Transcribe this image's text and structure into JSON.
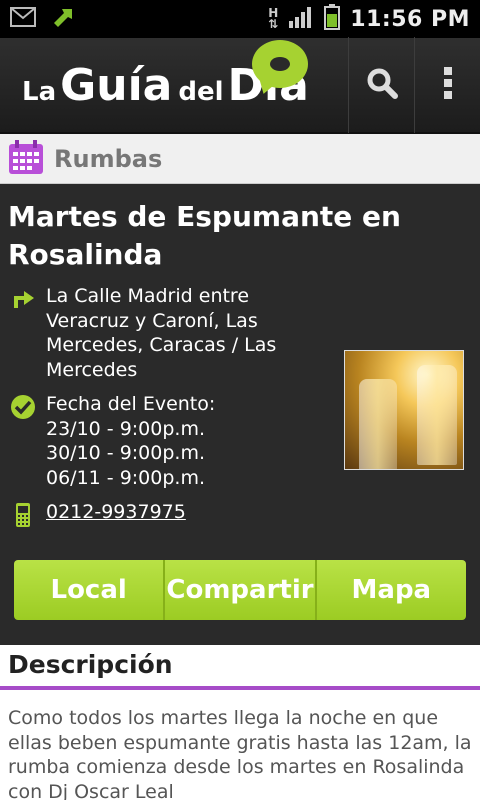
{
  "status_bar": {
    "time": "11:56 PM",
    "network_label": "H"
  },
  "app_bar": {
    "logo_word1": "La",
    "logo_word2": "Guía",
    "logo_word3": "del",
    "logo_word4": "Día",
    "search_icon": "search-icon",
    "overflow_icon": "overflow-menu-icon"
  },
  "category": {
    "icon": "calendar-icon",
    "label": "Rumbas"
  },
  "event": {
    "title": "Martes de Espumante en Rosalinda",
    "address": "La Calle Madrid entre Veracruz y Caroní, Las Mercedes, Caracas / Las Mercedes",
    "date_label": "Fecha del Evento:",
    "dates": [
      "23/10 - 9:00p.m.",
      "30/10 - 9:00p.m.",
      "06/11 - 9:00p.m."
    ],
    "phone": "0212-9937975"
  },
  "actions": {
    "local_label": "Local",
    "share_label": "Compartir",
    "map_label": "Mapa"
  },
  "description": {
    "heading": "Descripción",
    "text": "Como todos los martes llega la noche en que ellas beben espumante gratis hasta las 12am, la rumba comienza desde los martes en Rosalinda con Dj Oscar Leal"
  },
  "colors": {
    "accent_green": "#a6d231",
    "accent_purple": "#a64cc8",
    "dark_bg": "#2a2a2a"
  }
}
